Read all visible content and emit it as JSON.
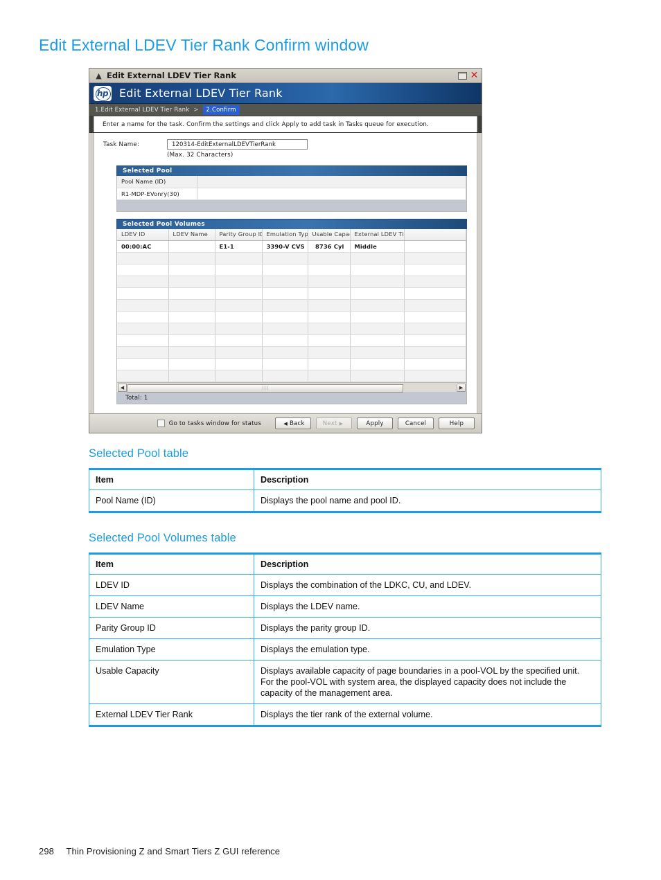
{
  "page": {
    "heading": "Edit External LDEV Tier Rank Confirm window",
    "footer_page_number": "298",
    "footer_title": "Thin Provisioning Z and Smart Tiers Z GUI reference",
    "accent_color": "#1b9ce0"
  },
  "dialog": {
    "titlebar": {
      "title": "Edit External LDEV Tier Rank",
      "collapse_icon": "chevron-up-icon",
      "restore_icon": "restore-icon",
      "close_icon": "close-icon"
    },
    "brandbar": {
      "logo_text": "hp",
      "title": "Edit External LDEV Tier Rank"
    },
    "breadcrumb": {
      "step1": "1.Edit External LDEV Tier Rank",
      "separator": ">",
      "step2": "2.Confirm"
    },
    "instruction": "Enter a name for the task. Confirm the settings and click Apply to add task in Tasks queue for execution.",
    "task": {
      "label": "Task Name:",
      "value": "120314-EditExternalLDEVTierRank",
      "hint": "(Max. 32 Characters)"
    },
    "selected_pool": {
      "panel_title": "Selected Pool",
      "columns": [
        "Pool Name (ID)",
        ""
      ],
      "rows": [
        [
          "R1-MDP-EVonry(30)",
          ""
        ]
      ]
    },
    "selected_pool_volumes": {
      "panel_title": "Selected Pool Volumes",
      "columns": [
        "LDEV ID",
        "LDEV Name",
        "Parity Group ID",
        "Emulation Type",
        "Usable Capacity",
        "External LDEV Tier Rank",
        ""
      ],
      "rows": [
        {
          "ldev_id": "00:00:AC",
          "ldev_name": "",
          "parity_group_id": "E1-1",
          "emulation_type": "3390-V CVS",
          "usable_capacity": "8736 Cyl",
          "external_ldev_tier_rank": "Middle",
          "extra": ""
        }
      ],
      "empty_row_count": 11,
      "total_label": "Total:  1",
      "scroll_left_icon": "arrow-left-icon",
      "scroll_right_icon": "arrow-right-icon"
    },
    "buttons": {
      "goto_tasks_label": "Go to tasks window for status",
      "goto_tasks_checked": false,
      "back": "Back",
      "next": "Next",
      "next_disabled": true,
      "apply": "Apply",
      "cancel": "Cancel",
      "help": "Help"
    }
  },
  "sections": [
    {
      "heading": "Selected Pool table",
      "columns": [
        "Item",
        "Description"
      ],
      "rows": [
        [
          "Pool Name (ID)",
          "Displays the pool name and pool ID."
        ]
      ]
    },
    {
      "heading": "Selected Pool Volumes table",
      "columns": [
        "Item",
        "Description"
      ],
      "rows": [
        [
          "LDEV ID",
          "Displays the combination of the LDKC, CU, and LDEV."
        ],
        [
          "LDEV Name",
          "Displays the LDEV name."
        ],
        [
          "Parity Group ID",
          "Displays the parity group ID."
        ],
        [
          "Emulation Type",
          "Displays the emulation type."
        ],
        [
          "Usable Capacity",
          "Displays available capacity of page boundaries in a pool-VOL by the specified unit. For the pool-VOL with system area, the displayed capacity does not include the capacity of the management area."
        ],
        [
          "External LDEV Tier Rank",
          "Displays the tier rank of the external volume."
        ]
      ]
    }
  ]
}
